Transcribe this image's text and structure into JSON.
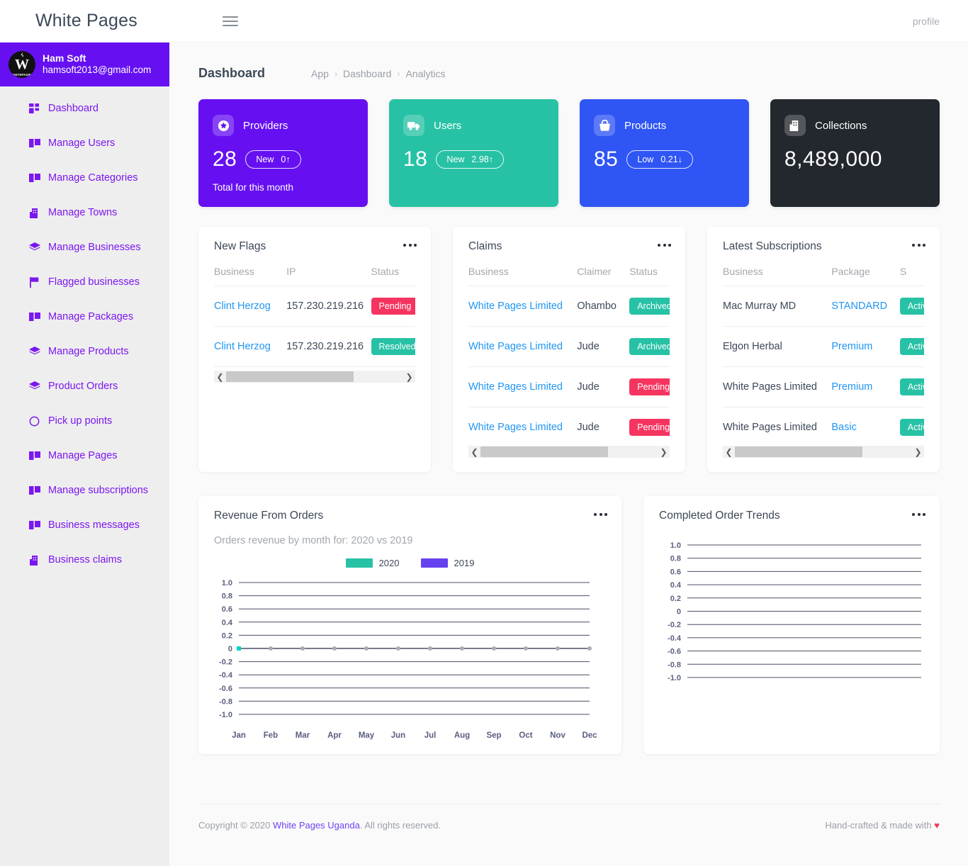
{
  "topbar": {
    "brand": "White Pages",
    "menu_icon": "hamburger-icon",
    "profile_label": "profile"
  },
  "sidebar": {
    "user": {
      "name": "Ham Soft",
      "email": "hamsoft2013@gmail.com",
      "avatar_letter": "W"
    },
    "items": [
      {
        "label": "Dashboard",
        "icon": "grid-icon"
      },
      {
        "label": "Manage Users",
        "icon": "book-icon"
      },
      {
        "label": "Manage Categories",
        "icon": "book-icon"
      },
      {
        "label": "Manage Towns",
        "icon": "building-icon"
      },
      {
        "label": "Manage Businesses",
        "icon": "layers-icon"
      },
      {
        "label": "Flagged businesses",
        "icon": "flag-icon"
      },
      {
        "label": "Manage Packages",
        "icon": "book-icon"
      },
      {
        "label": "Manage Products",
        "icon": "layers-icon"
      },
      {
        "label": "Product Orders",
        "icon": "layers-icon"
      },
      {
        "label": "Pick up points",
        "icon": "circle-icon"
      },
      {
        "label": "Manage Pages",
        "icon": "book-icon"
      },
      {
        "label": "Manage subscriptions",
        "icon": "book-icon"
      },
      {
        "label": "Business messages",
        "icon": "book-icon"
      },
      {
        "label": "Business claims",
        "icon": "building-icon"
      }
    ]
  },
  "header": {
    "title": "Dashboard",
    "breadcrumb": [
      "App",
      "Dashboard",
      "Analytics"
    ]
  },
  "stats": [
    {
      "label": "Providers",
      "value": "28",
      "pill_label": "New",
      "pill_value": "0",
      "pill_dir": "↑",
      "sub": "Total for this month",
      "color": "#6610f2",
      "icon": "star-badge-icon"
    },
    {
      "label": "Users",
      "value": "18",
      "pill_label": "New",
      "pill_value": "2.98",
      "pill_dir": "↑",
      "sub": "",
      "color": "#27c2a5",
      "icon": "truck-icon"
    },
    {
      "label": "Products",
      "value": "85",
      "pill_label": "Low",
      "pill_value": "0.21",
      "pill_dir": "↓",
      "sub": "",
      "color": "#2f55f5",
      "icon": "basket-icon"
    },
    {
      "label": "Collections",
      "value": "8,489,000",
      "pill_label": "",
      "pill_value": "",
      "pill_dir": "",
      "sub": "",
      "color": "#23272e",
      "icon": "building-icon"
    }
  ],
  "panels": {
    "new_flags": {
      "title": "New Flags",
      "columns": [
        "Business",
        "IP",
        "Status"
      ],
      "rows": [
        {
          "business": "Clint Herzog",
          "ip": "157.230.219.216",
          "status": "Pending",
          "status_kind": "pending"
        },
        {
          "business": "Clint Herzog",
          "ip": "157.230.219.216",
          "status": "Resolved",
          "status_kind": "resolved"
        }
      ]
    },
    "claims": {
      "title": "Claims",
      "columns": [
        "Business",
        "Claimer",
        "Status"
      ],
      "rows": [
        {
          "business": "White Pages Limited",
          "claimer": "Ohambo",
          "status": "Archived",
          "status_kind": "archived"
        },
        {
          "business": "White Pages Limited",
          "claimer": "Jude",
          "status": "Archived",
          "status_kind": "archived"
        },
        {
          "business": "White Pages Limited",
          "claimer": "Jude",
          "status": "Pending",
          "status_kind": "pending"
        },
        {
          "business": "White Pages Limited",
          "claimer": "Jude",
          "status": "Pending",
          "status_kind": "pending"
        }
      ]
    },
    "subscriptions": {
      "title": "Latest Subscriptions",
      "columns": [
        "Business",
        "Package",
        "S"
      ],
      "rows": [
        {
          "business": "Mac Murray MD",
          "package": "STANDARD",
          "status": "Active",
          "status_kind": "active"
        },
        {
          "business": "Elgon Herbal",
          "package": "Premium",
          "status": "Active",
          "status_kind": "active"
        },
        {
          "business": "White Pages Limited",
          "package": "Premium",
          "status": "Active",
          "status_kind": "active"
        },
        {
          "business": "White Pages Limited",
          "package": "Basic",
          "status": "Active",
          "status_kind": "active"
        }
      ]
    }
  },
  "chart_data": [
    {
      "type": "line",
      "title": "Revenue From Orders",
      "subtitle": "Orders revenue by month for: 2020 vs 2019",
      "xlabel": "",
      "ylabel": "",
      "ylim": [
        -1.0,
        1.0
      ],
      "grid": true,
      "legend_position": "top-center",
      "categories": [
        "Jan",
        "Feb",
        "Mar",
        "Apr",
        "May",
        "Jun",
        "Jul",
        "Aug",
        "Sep",
        "Oct",
        "Nov",
        "Dec"
      ],
      "yticks": [
        "1.0",
        "0.8",
        "0.6",
        "0.4",
        "0.2",
        "0",
        "-0.2",
        "-0.4",
        "-0.6",
        "-0.8",
        "-1.0"
      ],
      "series": [
        {
          "name": "2020",
          "color": "#27c2a5",
          "values": [
            0,
            0,
            0,
            0,
            0,
            0,
            0,
            0,
            0,
            0,
            0,
            0
          ]
        },
        {
          "name": "2019",
          "color": "#6741f0",
          "values": [
            0,
            0,
            0,
            0,
            0,
            0,
            0,
            0,
            0,
            0,
            0,
            0
          ]
        }
      ]
    },
    {
      "type": "line",
      "title": "Completed Order Trends",
      "subtitle": "",
      "xlabel": "",
      "ylabel": "",
      "ylim": [
        -1.0,
        1.0
      ],
      "grid": true,
      "legend_position": "none",
      "categories": [],
      "yticks": [
        "1.0",
        "0.8",
        "0.6",
        "0.4",
        "0.2",
        "0",
        "-0.2",
        "-0.4",
        "-0.6",
        "-0.8",
        "-1.0"
      ],
      "series": []
    }
  ],
  "footer": {
    "copyright_pre": "Copyright © 2020",
    "link": "White Pages Uganda",
    "copyright_post": ". All rights reserved.",
    "credit": "Hand-crafted & made with",
    "heart": "♥"
  }
}
